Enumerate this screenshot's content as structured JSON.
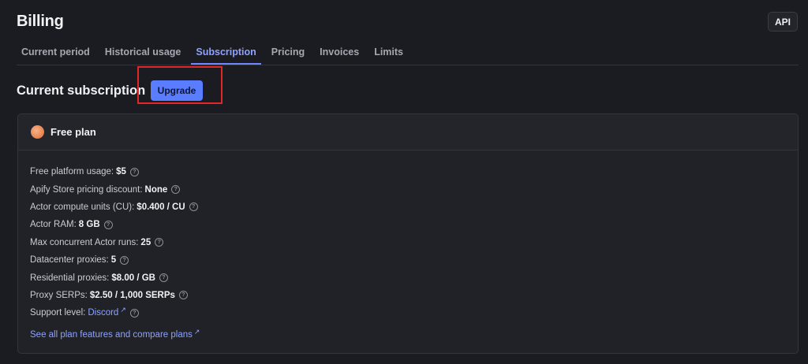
{
  "header": {
    "title": "Billing",
    "api_label": "API"
  },
  "tabs": [
    {
      "label": "Current period"
    },
    {
      "label": "Historical usage"
    },
    {
      "label": "Subscription",
      "active": true
    },
    {
      "label": "Pricing"
    },
    {
      "label": "Invoices"
    },
    {
      "label": "Limits"
    }
  ],
  "section": {
    "title": "Current subscription",
    "upgrade_label": "Upgrade"
  },
  "plan": {
    "name": "Free plan",
    "features": [
      {
        "label": "Free platform usage:",
        "value": "$5"
      },
      {
        "label": "Apify Store pricing discount:",
        "value": "None"
      },
      {
        "label": "Actor compute units (CU):",
        "value": "$0.400 / CU"
      },
      {
        "label": "Actor RAM:",
        "value": "8 GB"
      },
      {
        "label": "Max concurrent Actor runs:",
        "value": "25"
      },
      {
        "label": "Datacenter proxies:",
        "value": "5"
      },
      {
        "label": "Residential proxies:",
        "value": "$8.00 / GB"
      },
      {
        "label": "Proxy SERPs:",
        "value": "$2.50 / 1,000 SERPs"
      },
      {
        "label": "Support level:",
        "link": "Discord"
      }
    ],
    "see_all_label": "See all plan features and compare plans"
  },
  "colors": {
    "accent": "#5a7dff",
    "highlight": "#e3262a",
    "background": "#1b1c21"
  },
  "icons": {
    "help": "question-circle-icon",
    "external": "external-link-icon",
    "plan": "plan-dot-icon"
  }
}
